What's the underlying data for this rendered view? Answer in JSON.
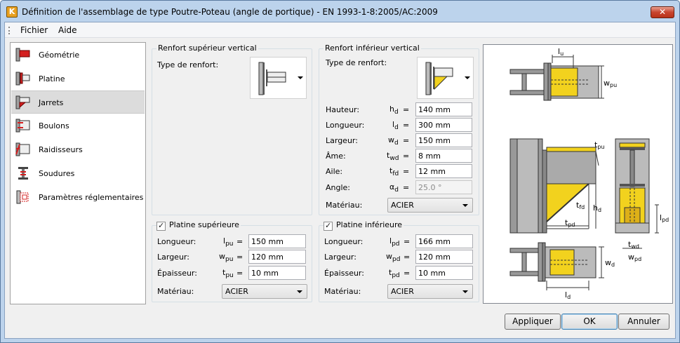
{
  "window": {
    "title": "Définition de l'assemblage de type Poutre-Poteau (angle de portique) - EN 1993-1-8:2005/AC:2009",
    "app_icon": "K",
    "close": "✕"
  },
  "menu": {
    "file": "Fichier",
    "help": "Aide"
  },
  "nav": {
    "items": [
      {
        "label": "Géométrie"
      },
      {
        "label": "Platine"
      },
      {
        "label": "Jarrets"
      },
      {
        "label": "Boulons"
      },
      {
        "label": "Raidisseurs"
      },
      {
        "label": "Soudures"
      },
      {
        "label": "Paramètres réglementaires"
      }
    ],
    "selected_index": 2
  },
  "upper_vertical": {
    "title": "Renfort supérieur vertical",
    "type_label": "Type de renfort:"
  },
  "lower_vertical": {
    "title": "Renfort inférieur vertical",
    "type_label": "Type de renfort:",
    "fields": [
      {
        "label": "Hauteur:",
        "sym": "h",
        "sub": "d",
        "value": "140 mm"
      },
      {
        "label": "Longueur:",
        "sym": "l",
        "sub": "d",
        "value": "300 mm"
      },
      {
        "label": "Largeur:",
        "sym": "w",
        "sub": "d",
        "value": "150 mm"
      },
      {
        "label": "Âme:",
        "sym": "t",
        "sub": "wd",
        "value": "8 mm"
      },
      {
        "label": "Aile:",
        "sym": "t",
        "sub": "fd",
        "value": "12 mm"
      },
      {
        "label": "Angle:",
        "sym": "α",
        "sub": "d",
        "value": "25.0 °"
      }
    ],
    "material_label": "Matériau:",
    "material": "ACIER"
  },
  "upper_plate": {
    "title": "Platine supérieure",
    "checked": true,
    "fields": [
      {
        "label": "Longueur:",
        "sym": "l",
        "sub": "pu",
        "value": "150 mm"
      },
      {
        "label": "Largeur:",
        "sym": "w",
        "sub": "pu",
        "value": "120 mm"
      },
      {
        "label": "Épaisseur:",
        "sym": "t",
        "sub": "pu",
        "value": "10 mm"
      }
    ],
    "material_label": "Matériau:",
    "material": "ACIER"
  },
  "lower_plate": {
    "title": "Platine inférieure",
    "checked": true,
    "fields": [
      {
        "label": "Longueur:",
        "sym": "l",
        "sub": "pd",
        "value": "166 mm"
      },
      {
        "label": "Largeur:",
        "sym": "w",
        "sub": "pd",
        "value": "120 mm"
      },
      {
        "label": "Épaisseur:",
        "sym": "t",
        "sub": "pd",
        "value": "10 mm"
      }
    ],
    "material_label": "Matériau:",
    "material": "ACIER"
  },
  "eq": "=",
  "check": "✓",
  "diagram": {
    "lu": "l",
    "lu_sub": "u",
    "wpu": "w",
    "wpu_sub": "pu",
    "tpu": "t",
    "tpu_sub": "pu",
    "tfd": "t",
    "tfd_sub": "fd",
    "hd": "h",
    "hd_sub": "d",
    "tpd": "t",
    "tpd_sub": "pd",
    "lpd": "l",
    "lpd_sub": "pd",
    "twd": "t",
    "twd_sub": "wd",
    "wpd": "w",
    "wpd_sub": "pd",
    "wd": "w",
    "wd_sub": "d",
    "ld": "l",
    "ld_sub": "d"
  },
  "buttons": {
    "apply": "Appliquer",
    "ok": "OK",
    "cancel": "Annuler"
  },
  "colors": {
    "accent_red": "#d42020",
    "steel": "#a8a8a8",
    "stiffener_yellow": "#f2d21e"
  }
}
